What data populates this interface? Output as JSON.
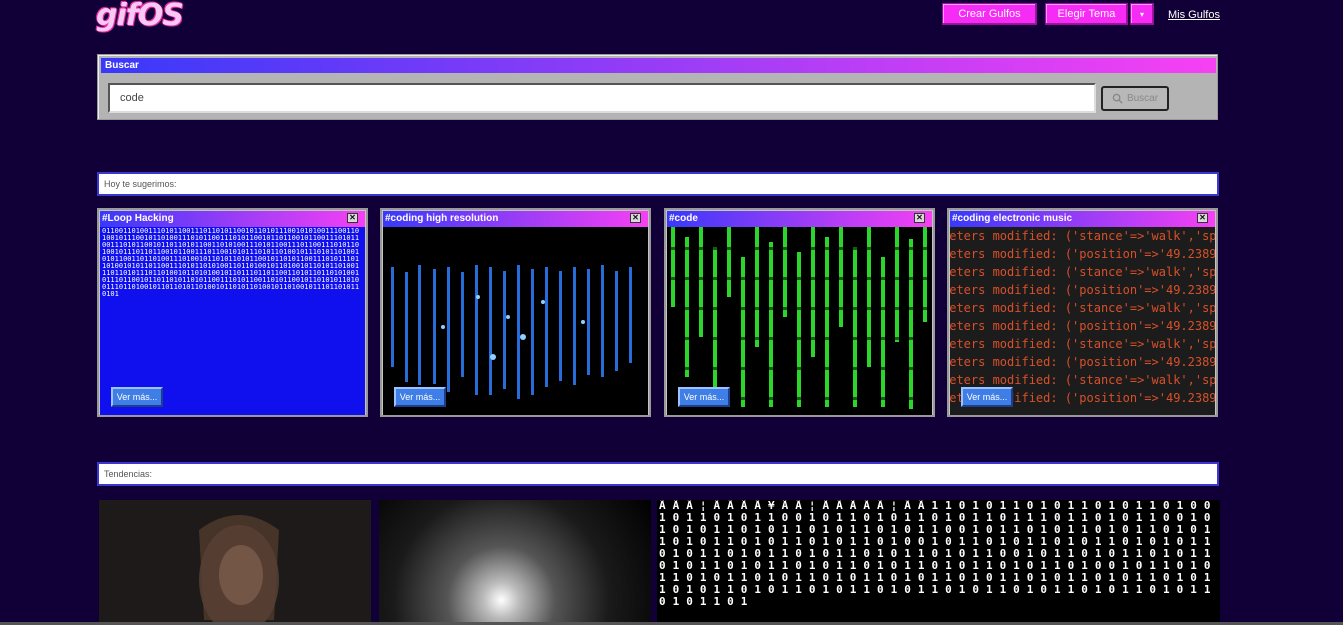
{
  "header": {
    "logo": "gifOS",
    "crear_label": "Crear Gulfos",
    "tema_label": "Elegir Tema",
    "tema_drop_icon": "▾",
    "mis_label": "Mis Gulfos"
  },
  "search": {
    "title": "Buscar",
    "value": "code",
    "button_label": "Buscar"
  },
  "suggestions": {
    "label": "Hoy te sugerimos:",
    "close_glyph": "✕",
    "cards": [
      {
        "title": "#Loop Hacking",
        "button": "Ver más..."
      },
      {
        "title": "#coding high resolution",
        "button": "Ver más..."
      },
      {
        "title": "#code",
        "button": "Ver más..."
      },
      {
        "title": "#coding electronic music",
        "button": "Ver más..."
      }
    ]
  },
  "trends": {
    "label": "Tendencias:"
  },
  "colors": {
    "background": "#110038",
    "accent_pink": "#f62bf6",
    "gradient_start": "#3939f9",
    "gradient_end": "#f740f4",
    "button_blue": "#3e7ee6"
  }
}
